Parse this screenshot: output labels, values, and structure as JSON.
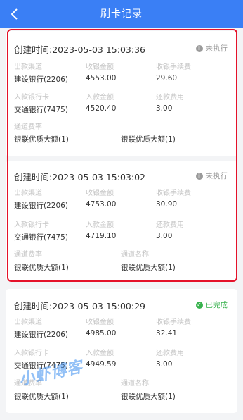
{
  "header": {
    "title": "刷卡记录"
  },
  "labels": {
    "out_channel": "出款渠道",
    "receipt_amount": "收银金额",
    "receipt_fee": "收银手续费",
    "in_card": "入款银行卡",
    "in_amount": "入款金额",
    "repay_fee": "还款费用",
    "channel_rate": "通道费率",
    "channel_name": "通道名称"
  },
  "records": [
    {
      "created": "创建时间:2023-05-03 15:03:36",
      "status": "未执行",
      "status_kind": "pending",
      "out_channel": "建设银行(2206)",
      "receipt_amount": "4553.00",
      "receipt_fee": "29.60",
      "in_card": "交通银行(7475)",
      "in_amount": "4520.40",
      "repay_fee": "3.00",
      "channel_rate": "",
      "channel_name": "银联优质大额(1)",
      "channel_rate_value": "银联优质大额(1)"
    },
    {
      "created": "创建时间:2023-05-03 15:03:02",
      "status": "未执行",
      "status_kind": "pending",
      "out_channel": "建设银行(2206)",
      "receipt_amount": "4753.00",
      "receipt_fee": "30.90",
      "in_card": "交通银行(7475)",
      "in_amount": "4719.10",
      "repay_fee": "3.00",
      "channel_name": "银联优质大额(1)",
      "channel_rate_value": "银联优质大额(1)"
    },
    {
      "created": "创建时间:2023-05-03 15:00:29",
      "status": "已完成",
      "status_kind": "done",
      "out_channel": "建设银行(2206)",
      "receipt_amount": "4985.00",
      "receipt_fee": "32.41",
      "in_card": "交通银行(7475)",
      "in_amount": "4949.59",
      "repay_fee": "3.00",
      "channel_name": "银联优质大额(1)",
      "channel_rate_value": "银联优质大额(1)"
    }
  ],
  "watermark": "小虾博客",
  "colors": {
    "header": "#3a7ff5",
    "highlight": "#e5122a",
    "done": "#37b24d",
    "pending": "#9a9a9a"
  }
}
